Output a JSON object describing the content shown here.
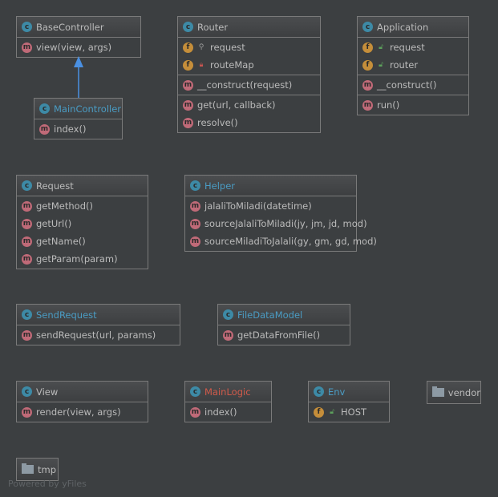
{
  "classes": [
    {
      "id": "BaseController",
      "title": "BaseController",
      "title_color": "#bbbbbb",
      "sections": [
        [
          {
            "kind": "m",
            "name": "view(view, args)"
          }
        ]
      ]
    },
    {
      "id": "Router",
      "title": "Router",
      "title_color": "#bbbbbb",
      "sections": [
        [
          {
            "kind": "f",
            "vis": "protected-key",
            "name": "request"
          },
          {
            "kind": "f",
            "vis": "private-lock",
            "name": "routeMap"
          }
        ],
        [
          {
            "kind": "m",
            "name": "__construct(request)"
          }
        ],
        [
          {
            "kind": "m",
            "name": "get(url, callback)"
          },
          {
            "kind": "m",
            "name": "resolve()"
          }
        ]
      ]
    },
    {
      "id": "Application",
      "title": "Application",
      "title_color": "#bbbbbb",
      "sections": [
        [
          {
            "kind": "f",
            "vis": "public-lock",
            "name": "request"
          },
          {
            "kind": "f",
            "vis": "public-lock",
            "name": "router"
          }
        ],
        [
          {
            "kind": "m",
            "name": "__construct()"
          }
        ],
        [
          {
            "kind": "m",
            "name": "run()"
          }
        ]
      ]
    },
    {
      "id": "MainController",
      "title": "MainController",
      "title_color": "#4a9cc4",
      "sections": [
        [
          {
            "kind": "m",
            "name": "index()"
          }
        ]
      ]
    },
    {
      "id": "Request",
      "title": "Request",
      "title_color": "#bbbbbb",
      "sections": [
        [
          {
            "kind": "m",
            "name": "getMethod()"
          },
          {
            "kind": "m",
            "name": "getUrl()"
          },
          {
            "kind": "m",
            "name": "getName()"
          },
          {
            "kind": "m",
            "name": "getParam(param)"
          }
        ]
      ]
    },
    {
      "id": "Helper",
      "title": "Helper",
      "title_color": "#4a9cc4",
      "sections": [
        [
          {
            "kind": "m",
            "name": "jalaliToMiladi(datetime)"
          },
          {
            "kind": "m",
            "name": "sourceJalaliToMiladi(jy, jm, jd, mod)"
          },
          {
            "kind": "m",
            "name": "sourceMiladiToJalali(gy, gm, gd, mod)"
          }
        ]
      ]
    },
    {
      "id": "SendRequest",
      "title": "SendRequest",
      "title_color": "#4a9cc4",
      "sections": [
        [
          {
            "kind": "m",
            "name": "sendRequest(url, params)"
          }
        ]
      ]
    },
    {
      "id": "FileDataModel",
      "title": "FileDataModel",
      "title_color": "#4a9cc4",
      "sections": [
        [
          {
            "kind": "m",
            "name": "getDataFromFile()"
          }
        ]
      ]
    },
    {
      "id": "View",
      "title": "View",
      "title_color": "#bbbbbb",
      "sections": [
        [
          {
            "kind": "m",
            "name": "render(view, args)"
          }
        ]
      ]
    },
    {
      "id": "MainLogic",
      "title": "MainLogic",
      "title_color": "#d05a4a",
      "sections": [
        [
          {
            "kind": "m",
            "name": "index()"
          }
        ]
      ]
    },
    {
      "id": "Env",
      "title": "Env",
      "title_color": "#4a9cc4",
      "sections": [
        [
          {
            "kind": "f",
            "vis": "public-lock",
            "name": "HOST"
          }
        ]
      ]
    }
  ],
  "folders": [
    {
      "id": "vendor",
      "label": "vendor"
    },
    {
      "id": "tmp",
      "label": "tmp"
    }
  ],
  "colors": {
    "inheritance_arrow": "#4a90e2"
  },
  "footer": "Powered by yFiles"
}
